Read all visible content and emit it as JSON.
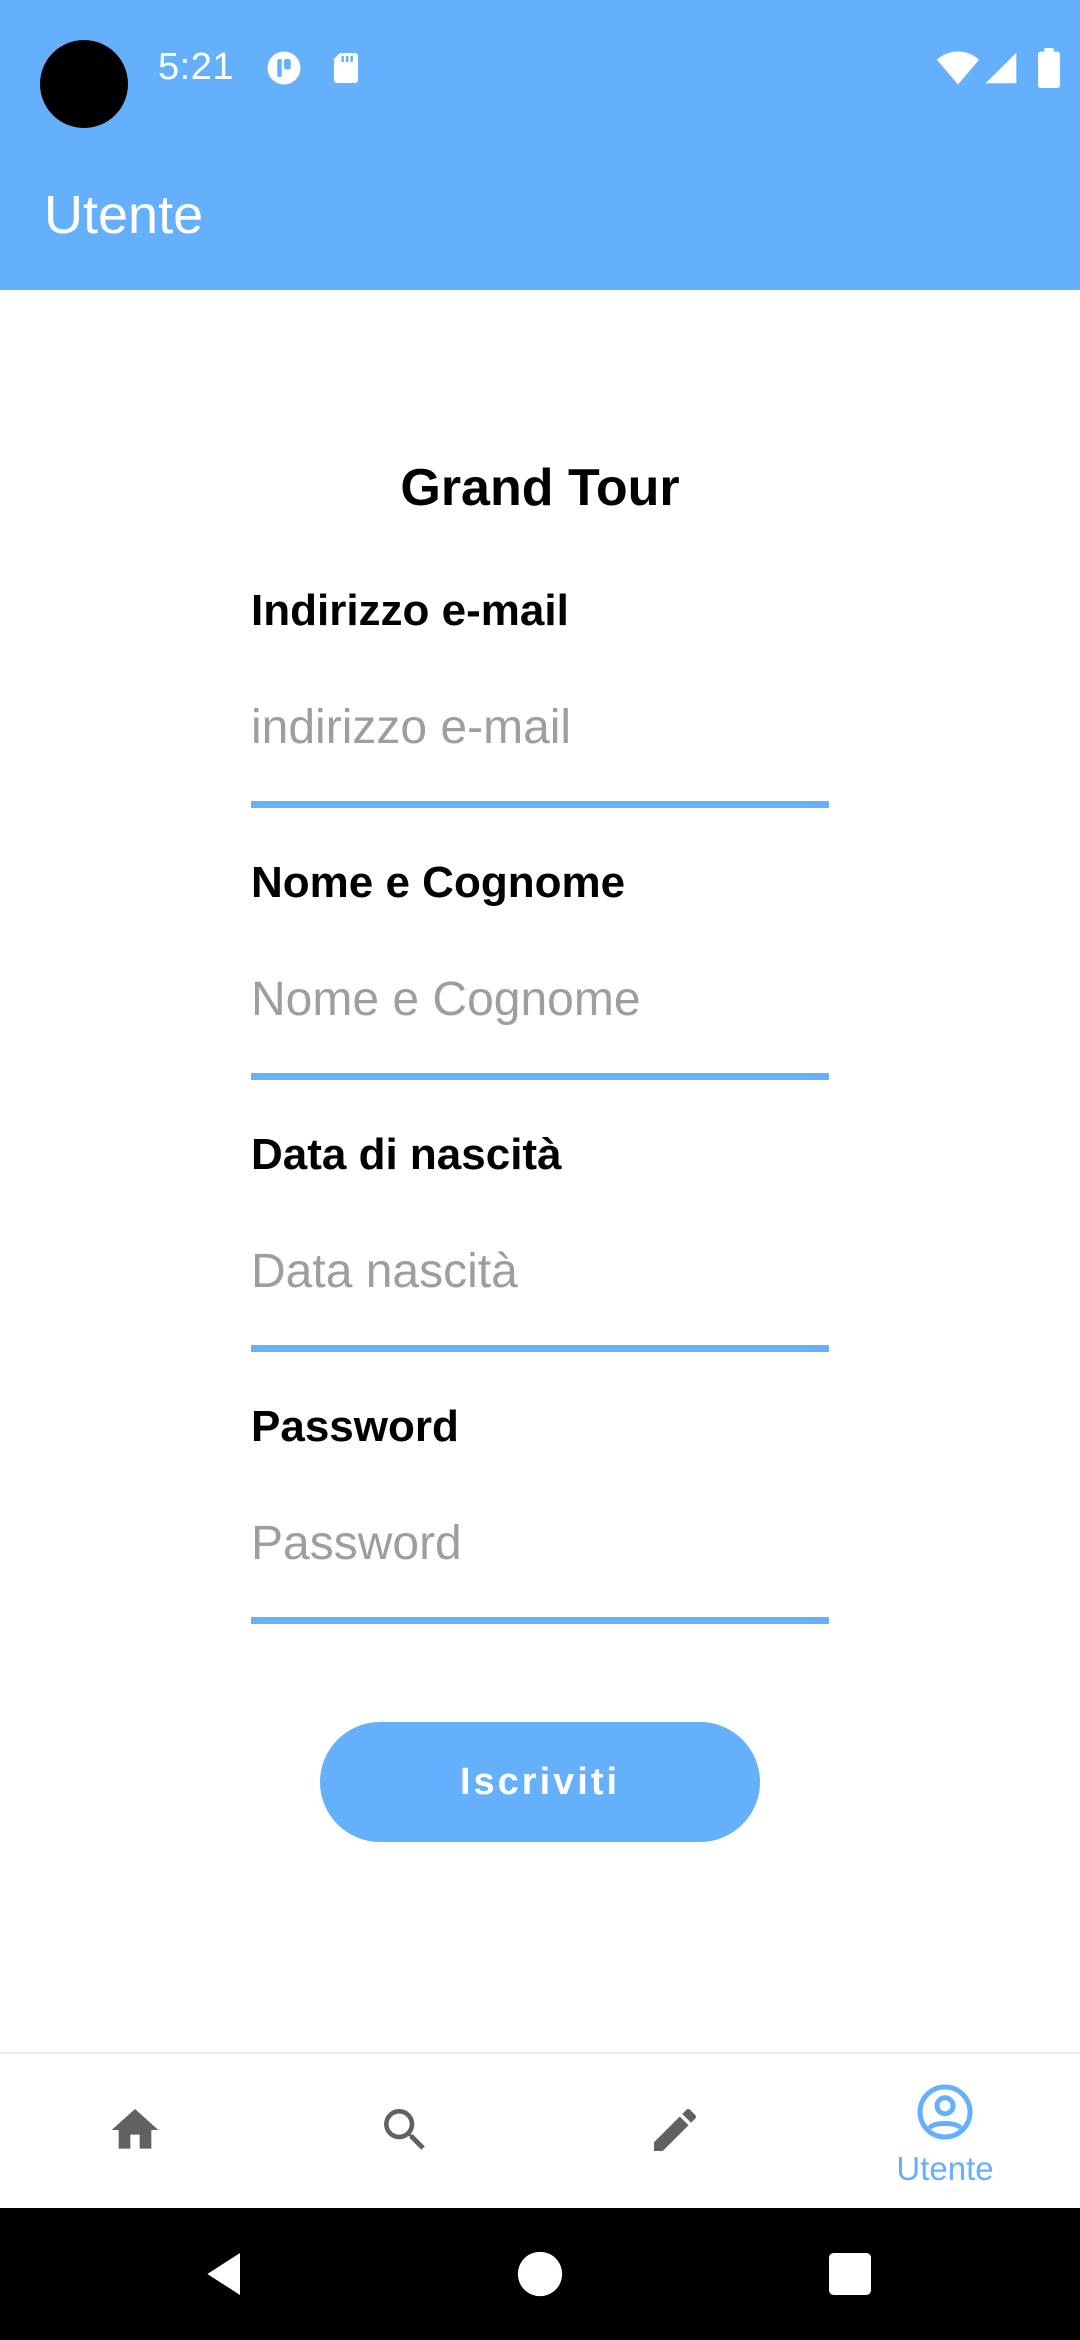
{
  "status_bar": {
    "time": "5:21",
    "icons": [
      "notification-icon",
      "sd-card-icon",
      "wifi-icon",
      "signal-icon",
      "battery-icon"
    ]
  },
  "app_bar": {
    "title": "Utente"
  },
  "form": {
    "title": "Grand Tour",
    "fields": [
      {
        "label": "Indirizzo e-mail",
        "placeholder": "indirizzo e-mail",
        "value": ""
      },
      {
        "label": "Nome e Cognome",
        "placeholder": "Nome e Cognome",
        "value": ""
      },
      {
        "label": "Data di nascità",
        "placeholder": "Data nascità",
        "value": ""
      },
      {
        "label": "Password",
        "placeholder": "Password",
        "value": ""
      }
    ],
    "submit_label": "Iscriviti"
  },
  "bottom_nav": {
    "items": [
      {
        "icon": "home-icon",
        "label": ""
      },
      {
        "icon": "search-icon",
        "label": ""
      },
      {
        "icon": "pencil-icon",
        "label": ""
      },
      {
        "icon": "account-circle-icon",
        "label": "Utente",
        "active": true
      }
    ]
  },
  "colors": {
    "primary": "#64B0FC",
    "inactive_icon": "#616161",
    "placeholder": "#9E9E9E",
    "text": "#000000"
  }
}
